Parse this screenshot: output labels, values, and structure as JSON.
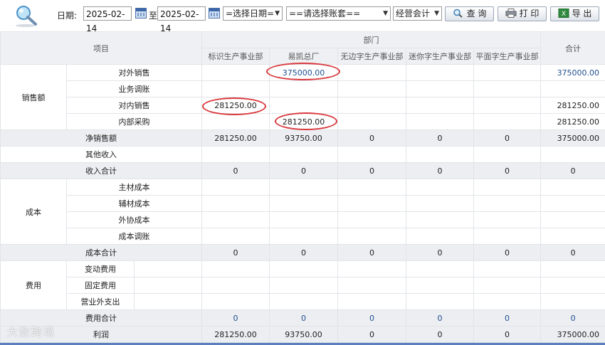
{
  "toolbar": {
    "date_label": "日期:",
    "date_from": "2025-02-14",
    "to_label": "至",
    "date_to": "2025-02-14",
    "date_select": "=选择日期=",
    "account_select": "==请选择账套==",
    "mode_select": "经营会计",
    "query_label": "查 询",
    "print_label": "打 印",
    "export_label": "导 出"
  },
  "table": {
    "item_header": "项目",
    "dept_header": "部门",
    "total_header": "合计",
    "departments": [
      "标识生产事业部",
      "易凯总厂",
      "无边字生产事业部",
      "迷你字生产事业部",
      "平面字生产事业部"
    ],
    "groups": {
      "sales": "销售额",
      "cost": "成本",
      "expense": "费用"
    },
    "rows": [
      {
        "label": "对外销售",
        "values": [
          "",
          "375000.00",
          "",
          "",
          ""
        ],
        "total": "375000.00"
      },
      {
        "label": "业务调账",
        "values": [
          "",
          "",
          "",
          "",
          ""
        ],
        "total": ""
      },
      {
        "label": "对内销售",
        "values": [
          "281250.00",
          "",
          "",
          "",
          ""
        ],
        "total": "281250.00"
      },
      {
        "label": "内部采购",
        "values": [
          "",
          "281250.00",
          "",
          "",
          ""
        ],
        "total": "281250.00"
      },
      {
        "label": "净销售额",
        "values": [
          "281250.00",
          "93750.00",
          "0",
          "0",
          "0"
        ],
        "total": "375000.00"
      },
      {
        "label": "其他收入",
        "values": [
          "",
          "",
          "",
          "",
          ""
        ],
        "total": ""
      },
      {
        "label": "收入合计",
        "values": [
          "0",
          "0",
          "0",
          "0",
          "0"
        ],
        "total": "0"
      },
      {
        "label": "主材成本",
        "values": [
          "",
          "",
          "",
          "",
          ""
        ],
        "total": ""
      },
      {
        "label": "辅材成本",
        "values": [
          "",
          "",
          "",
          "",
          ""
        ],
        "total": ""
      },
      {
        "label": "外协成本",
        "values": [
          "",
          "",
          "",
          "",
          ""
        ],
        "total": ""
      },
      {
        "label": "成本调账",
        "values": [
          "",
          "",
          "",
          "",
          ""
        ],
        "total": ""
      },
      {
        "label": "成本合计",
        "values": [
          "0",
          "0",
          "0",
          "0",
          "0"
        ],
        "total": "0"
      },
      {
        "label": "变动费用",
        "values": [
          "",
          "",
          "",
          "",
          ""
        ],
        "total": ""
      },
      {
        "label": "固定费用",
        "values": [
          "",
          "",
          "",
          "",
          ""
        ],
        "total": ""
      },
      {
        "label": "营业外支出",
        "values": [
          "",
          "",
          "",
          "",
          ""
        ],
        "total": ""
      },
      {
        "label": "费用合计",
        "values": [
          "0",
          "0",
          "0",
          "0",
          "0"
        ],
        "total": "0"
      },
      {
        "label": "利润",
        "values": [
          "281250.00",
          "93750.00",
          "0",
          "0",
          "0"
        ],
        "total": "375000.00"
      }
    ]
  },
  "watermark": "大数跨境",
  "colors": {
    "link_blue": "#1f4e91",
    "highlight_red": "#d9383c",
    "header_bg": "#eef0f3"
  }
}
